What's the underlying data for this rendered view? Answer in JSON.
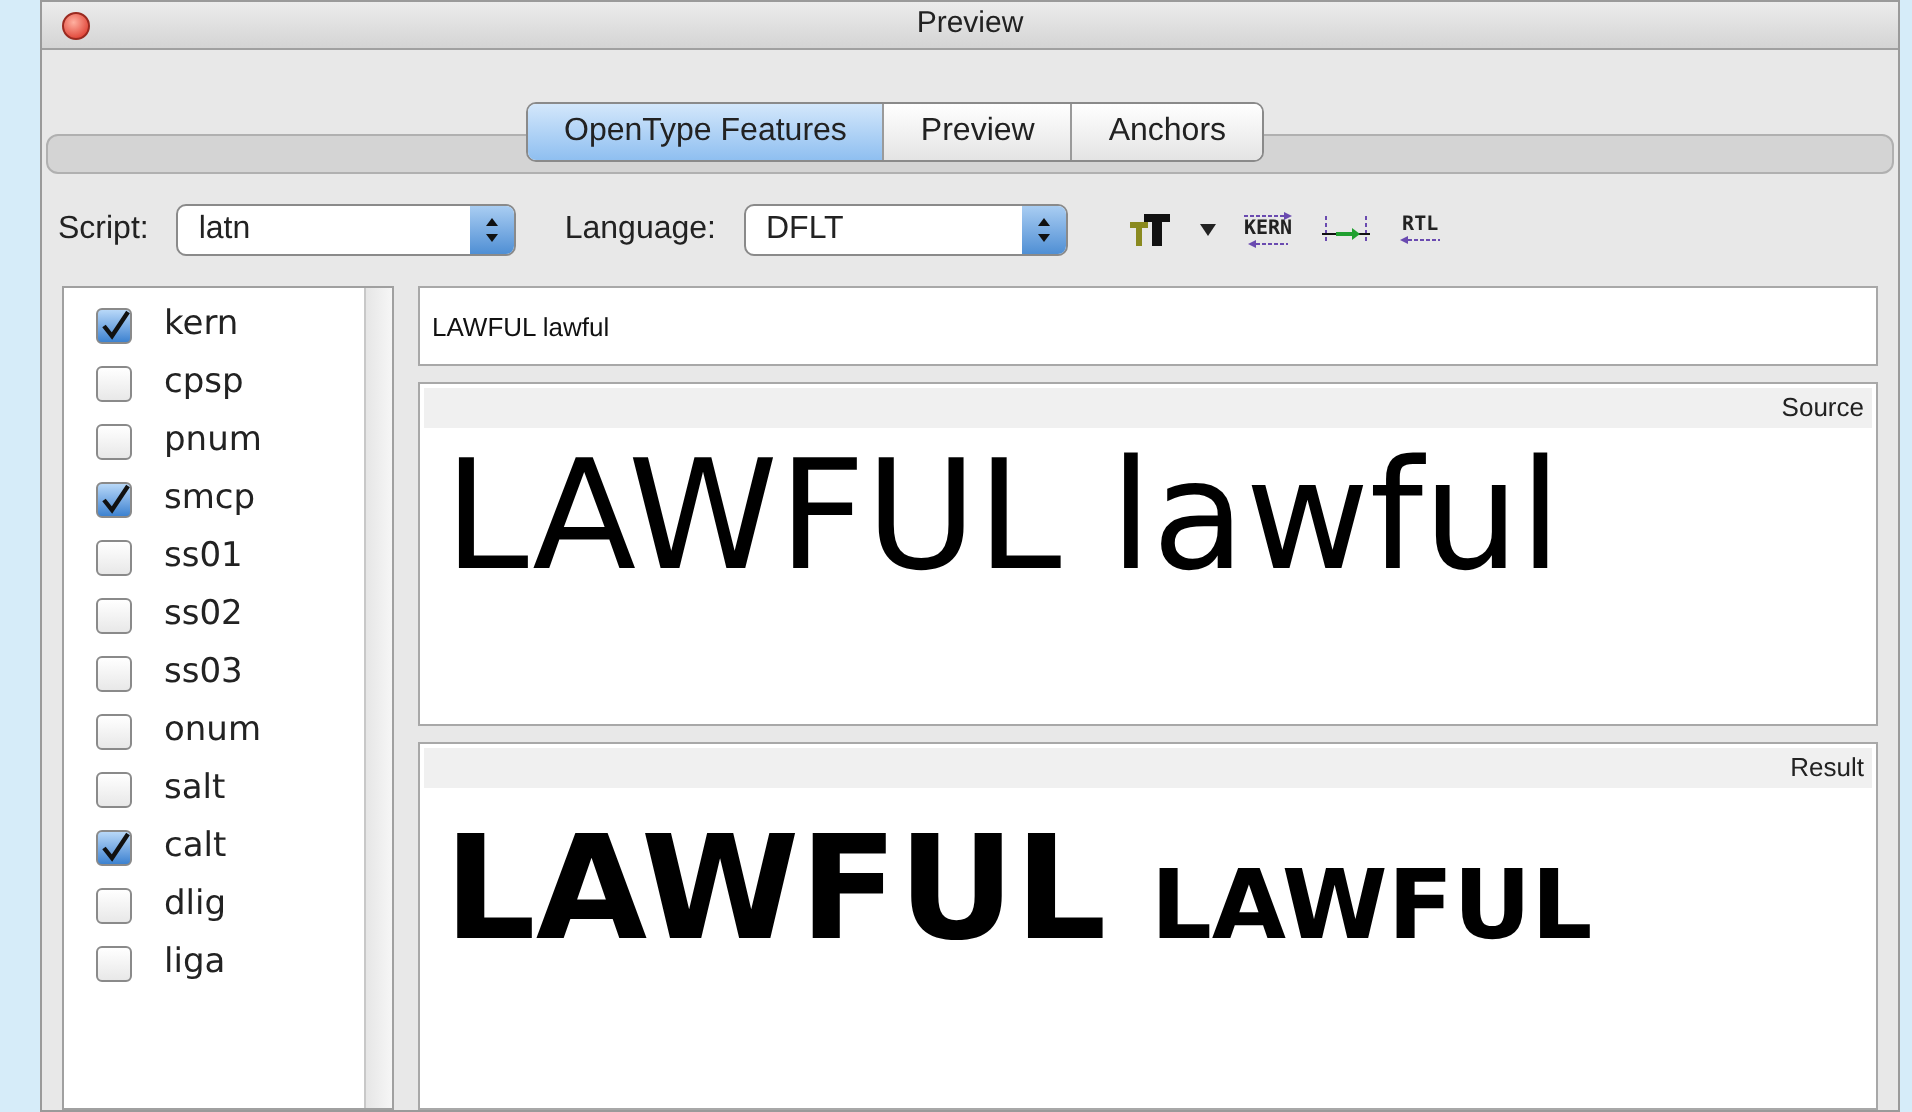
{
  "window": {
    "title": "Preview"
  },
  "tabs": [
    {
      "label": "OpenType Features",
      "selected": true
    },
    {
      "label": "Preview",
      "selected": false
    },
    {
      "label": "Anchors",
      "selected": false
    }
  ],
  "script": {
    "label": "Script:",
    "value": "latn"
  },
  "language": {
    "label": "Language:",
    "value": "DFLT"
  },
  "toolbar": [
    {
      "kind": "tt"
    },
    {
      "kind": "caret"
    },
    {
      "kind": "kern",
      "label": "KERN"
    },
    {
      "kind": "spacing"
    },
    {
      "kind": "rtl",
      "label": "RTL"
    }
  ],
  "features": [
    {
      "label": "kern",
      "checked": true
    },
    {
      "label": "cpsp",
      "checked": false
    },
    {
      "label": "pnum",
      "checked": false
    },
    {
      "label": "smcp",
      "checked": true
    },
    {
      "label": "ss01",
      "checked": false
    },
    {
      "label": "ss02",
      "checked": false
    },
    {
      "label": "ss03",
      "checked": false
    },
    {
      "label": "onum",
      "checked": false
    },
    {
      "label": "salt",
      "checked": false
    },
    {
      "label": "calt",
      "checked": true
    },
    {
      "label": "dlig",
      "checked": false
    },
    {
      "label": "liga",
      "checked": false
    }
  ],
  "input": {
    "value": "LAWFUL lawful"
  },
  "source": {
    "label": "Source",
    "text": "LAWFUL lawful"
  },
  "result": {
    "label": "Result",
    "words": [
      {
        "text": "LAWFUL",
        "small_caps": false
      },
      {
        "text": "LAWFUL",
        "small_caps": true
      }
    ]
  }
}
